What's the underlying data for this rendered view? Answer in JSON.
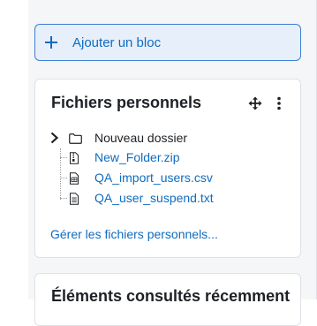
{
  "add_block": {
    "label": "Ajouter un bloc",
    "icon": "plus-icon"
  },
  "private_files_block": {
    "title": "Fichiers personnels",
    "move_icon": "move-icon",
    "menu_icon": "kebab-menu-icon",
    "folder": {
      "name": "Nouveau dossier",
      "expand_icon": "chevron-right-icon",
      "icon": "folder-icon"
    },
    "files": [
      {
        "name": "New_Folder.zip",
        "icon": "file-zip-icon"
      },
      {
        "name": "QA_import_users.csv",
        "icon": "file-csv-icon"
      },
      {
        "name": "QA_user_suspend.txt",
        "icon": "file-text-icon"
      }
    ],
    "manage_link": "Gérer les fichiers personnels..."
  },
  "recent_items_block": {
    "title": "Éléments consultés récemment"
  },
  "colors": {
    "link": "#0f6cbf",
    "add_block_bg": "#e7effa",
    "add_block_border": "#3d7fd3",
    "drawer_bg": "#f5f6f7",
    "card_border": "#dee2e6",
    "text": "#1d2125"
  }
}
